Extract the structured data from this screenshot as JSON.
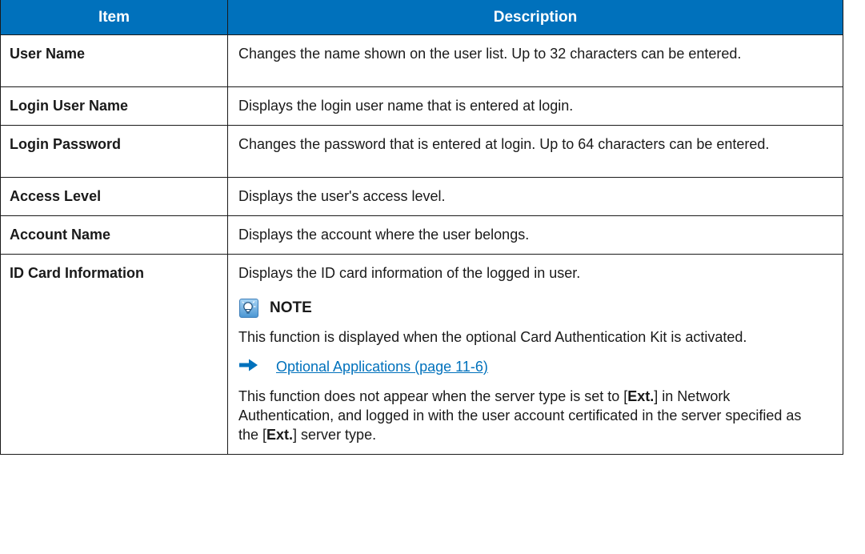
{
  "table": {
    "headers": {
      "item": "Item",
      "description": "Description"
    },
    "rows": [
      {
        "item": "User Name",
        "description": "Changes the name shown on the user list. Up to 32 characters can be entered."
      },
      {
        "item": "Login User Name",
        "description": "Displays the login user name that is entered at login."
      },
      {
        "item": "Login Password",
        "description": "Changes the password that is entered at login. Up to 64 characters can be entered."
      },
      {
        "item": "Access Level",
        "description": "Displays the user's access level."
      },
      {
        "item": "Account Name",
        "description": "Displays the account where the user belongs."
      },
      {
        "item": "ID Card Information",
        "description": "Displays the ID card information of the logged in user.",
        "note": {
          "title": "NOTE",
          "icon": "lightbulb-note-icon",
          "text": "This function is displayed when the optional Card Authentication Kit is activated.",
          "reference_icon": "right-arrow-icon",
          "reference_link": "Optional Applications (page 11-6)",
          "extra": {
            "part1": "This function does not appear when the server type is set to [",
            "bold1": "Ext.",
            "part2": "] in Network Authentication, and logged in with the user account certificated in the server specified as the [",
            "bold2": "Ext.",
            "part3": "] server type."
          }
        }
      }
    ]
  },
  "colors": {
    "header_bg": "#0071bc",
    "header_text": "#ffffff",
    "link": "#0071bc",
    "border": "#1a1a1a"
  }
}
